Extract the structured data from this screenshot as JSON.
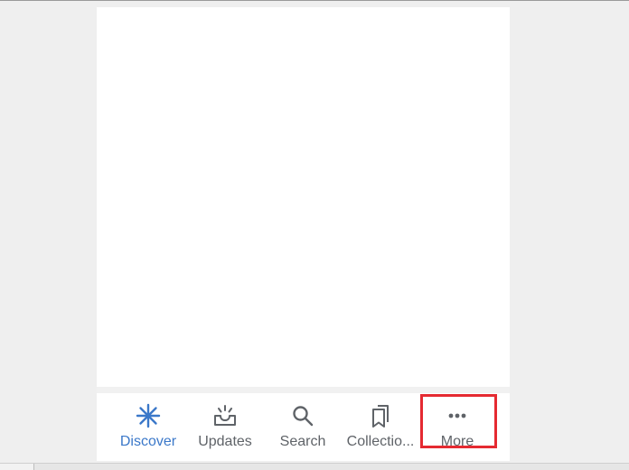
{
  "nav": {
    "items": [
      {
        "label": "Discover",
        "icon": "discover-icon",
        "active": true
      },
      {
        "label": "Updates",
        "icon": "updates-icon",
        "active": false
      },
      {
        "label": "Search",
        "icon": "search-icon",
        "active": false
      },
      {
        "label": "Collectio...",
        "icon": "collections-icon",
        "active": false
      },
      {
        "label": "More",
        "icon": "more-icon",
        "active": false
      }
    ]
  },
  "colors": {
    "accent": "#3b78c9",
    "inactive": "#5f6368",
    "highlight": "#e52a31"
  }
}
